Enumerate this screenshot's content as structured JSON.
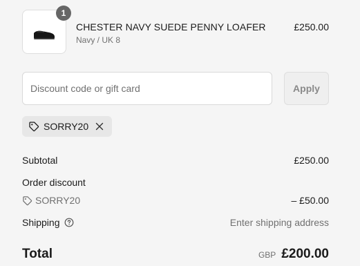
{
  "line_item": {
    "quantity": "1",
    "name": "CHESTER NAVY SUEDE PENNY LOAFER",
    "variant": "Navy / UK 8",
    "price": "£250.00",
    "image_icon": "loafer-shoe-image"
  },
  "discount": {
    "placeholder": "Discount code or gift card",
    "value": "",
    "apply_label": "Apply",
    "applied_code": "SORRY20"
  },
  "summary": {
    "subtotal_label": "Subtotal",
    "subtotal_value": "£250.00",
    "order_discount_label": "Order discount",
    "discount_code": "SORRY20",
    "discount_value": "– £50.00",
    "shipping_label": "Shipping",
    "shipping_value": "Enter shipping address",
    "total_label": "Total",
    "currency": "GBP",
    "total_value": "£200.00"
  },
  "colors": {
    "background": "#f5f5f5",
    "badge": "#666666",
    "muted_text": "#707070"
  }
}
